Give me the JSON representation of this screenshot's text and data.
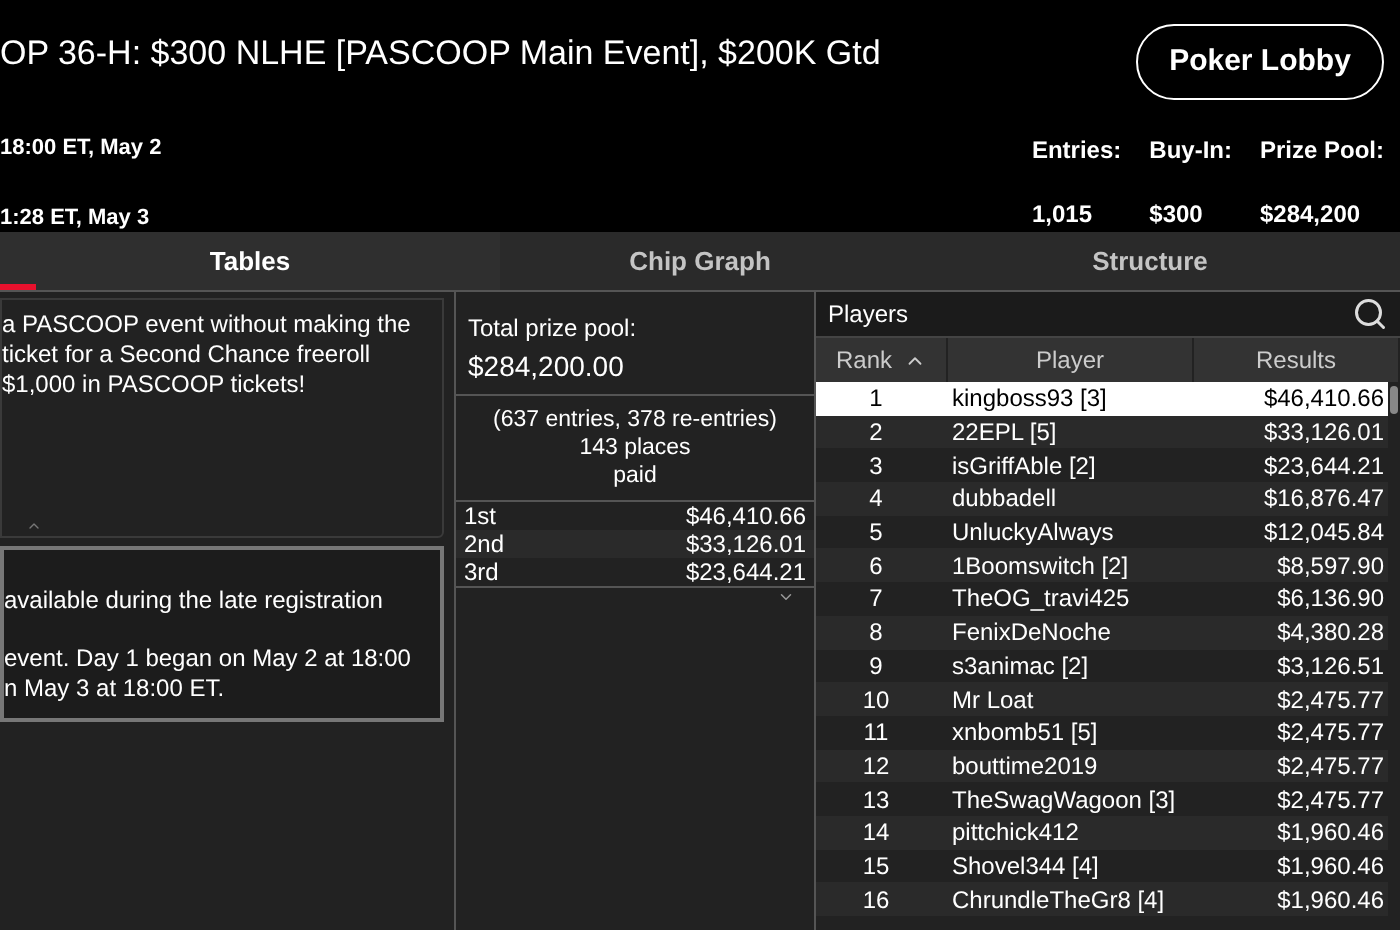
{
  "header": {
    "title": "OP 36-H: $300 NLHE [PASCOOP Main Event], $200K Gtd",
    "lines": [
      "18:00 ET, May 2",
      "1:28 ET, May 3"
    ],
    "lobby_button": "Poker Lobby",
    "stats": [
      {
        "label": "Entries:",
        "value": "1,015"
      },
      {
        "label": "Buy-In:",
        "value": "$300"
      },
      {
        "label": "Prize Pool:",
        "value": "$284,200"
      }
    ]
  },
  "tabs": [
    {
      "label": "Tables",
      "selected": true
    },
    {
      "label": "Chip Graph",
      "selected": false
    },
    {
      "label": "Structure",
      "selected": false
    }
  ],
  "info_panels": [
    {
      "lines": [
        "a PASCOOP event without making the",
        "ticket for a Second Chance freeroll",
        "$1,000 in PASCOOP tickets!"
      ]
    },
    {
      "lines": [
        "available during the late registration",
        "event. Day 1 began on May 2 at 18:00",
        "n May 3 at 18:00 ET."
      ]
    }
  ],
  "prizes": {
    "total_label": "Total prize pool:",
    "total": "$284,200.00",
    "summary": [
      "(637 entries, 378 re-entries)",
      "143 places",
      "paid"
    ],
    "places": [
      {
        "place": "1st",
        "amount": "$46,410.66"
      },
      {
        "place": "2nd",
        "amount": "$33,126.01"
      },
      {
        "place": "3rd",
        "amount": "$23,644.21"
      }
    ]
  },
  "players": {
    "title": "Players",
    "columns": [
      "Rank",
      "Player",
      "Results"
    ],
    "rows": [
      {
        "rank": "1",
        "player": "kingboss93 [3]",
        "result": "$46,410.66",
        "selected": true
      },
      {
        "rank": "2",
        "player": "22EPL [5]",
        "result": "$33,126.01",
        "selected": false
      },
      {
        "rank": "3",
        "player": "isGriffAble [2]",
        "result": "$23,644.21",
        "selected": false
      },
      {
        "rank": "4",
        "player": "dubbadell",
        "result": "$16,876.47",
        "selected": false
      },
      {
        "rank": "5",
        "player": "UnluckyAlways",
        "result": "$12,045.84",
        "selected": false
      },
      {
        "rank": "6",
        "player": "1Boomswitch [2]",
        "result": "$8,597.90",
        "selected": false
      },
      {
        "rank": "7",
        "player": "TheOG_travi425",
        "result": "$6,136.90",
        "selected": false
      },
      {
        "rank": "8",
        "player": "FenixDeNoche",
        "result": "$4,380.28",
        "selected": false
      },
      {
        "rank": "9",
        "player": "s3animac [2]",
        "result": "$3,126.51",
        "selected": false
      },
      {
        "rank": "10",
        "player": "Mr Loat",
        "result": "$2,475.77",
        "selected": false
      },
      {
        "rank": "11",
        "player": "xnbomb51 [5]",
        "result": "$2,475.77",
        "selected": false
      },
      {
        "rank": "12",
        "player": "bouttime2019",
        "result": "$2,475.77",
        "selected": false
      },
      {
        "rank": "13",
        "player": "TheSwagWagoon [3]",
        "result": "$2,475.77",
        "selected": false
      },
      {
        "rank": "14",
        "player": "pittchick412",
        "result": "$1,960.46",
        "selected": false
      },
      {
        "rank": "15",
        "player": "Shovel344 [4]",
        "result": "$1,960.46",
        "selected": false
      },
      {
        "rank": "16",
        "player": "ChrundleTheGr8 [4]",
        "result": "$1,960.46",
        "selected": false
      }
    ]
  }
}
